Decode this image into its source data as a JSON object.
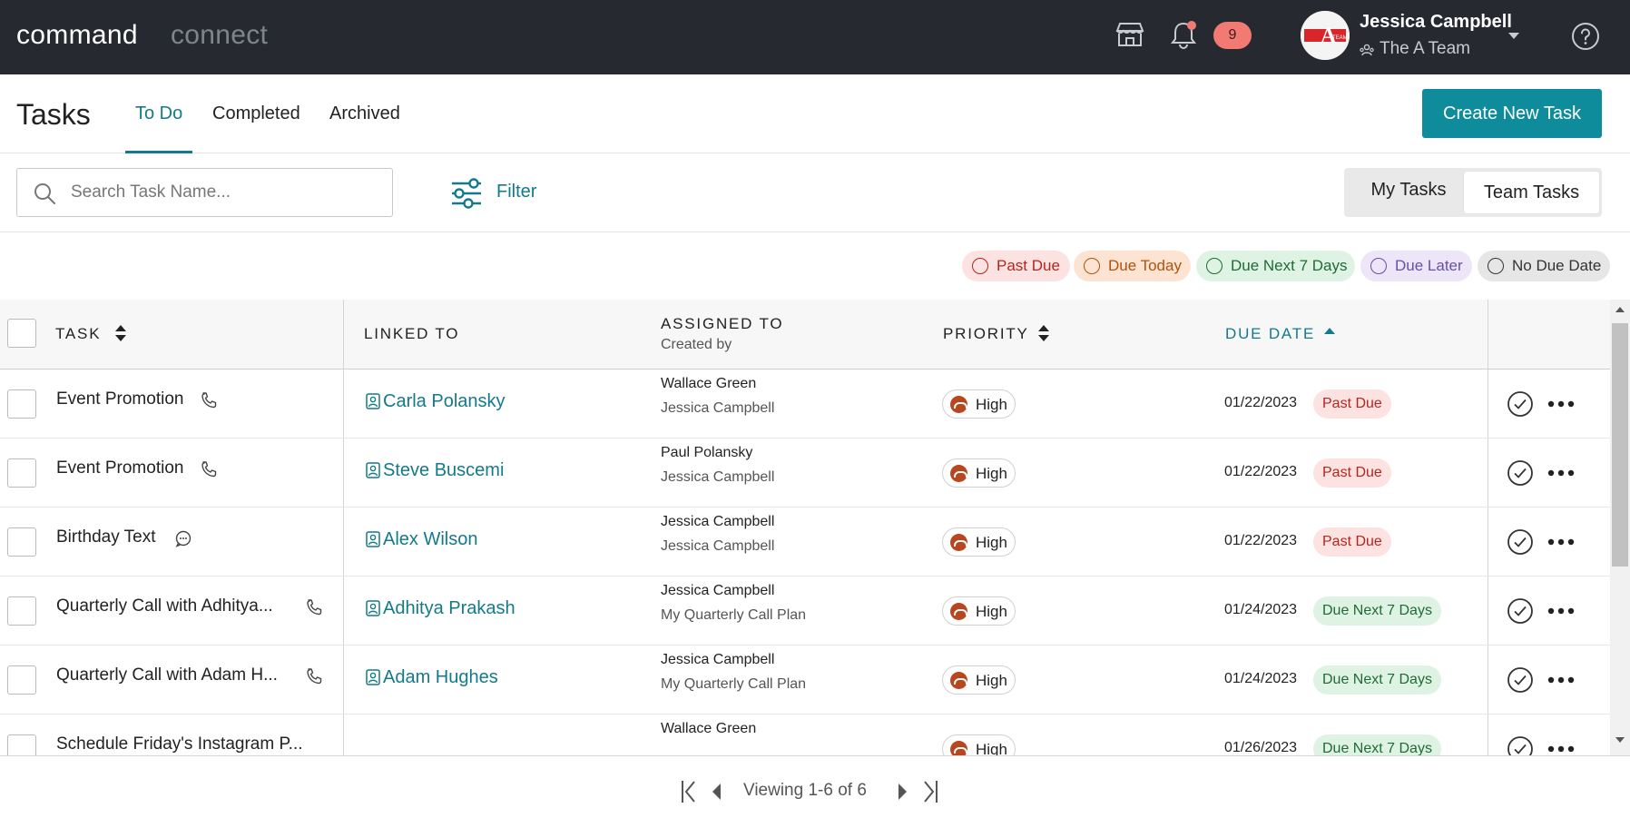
{
  "app": {
    "brand_primary": "command",
    "brand_secondary": "connect"
  },
  "topbar": {
    "notification_count": "9",
    "user_name": "Jessica Campbell",
    "team_name": "The A Team",
    "avatar_text": "A",
    "avatar_subtext": "TEAM"
  },
  "header": {
    "title": "Tasks",
    "tabs": [
      {
        "label": "To Do"
      },
      {
        "label": "Completed"
      },
      {
        "label": "Archived"
      }
    ],
    "active_tab": "To Do",
    "create_button": "Create New Task"
  },
  "toolbar": {
    "search_placeholder": "Search Task Name...",
    "search_value": "",
    "filter_label": "Filter",
    "view_toggle": [
      {
        "label": "My Tasks"
      },
      {
        "label": "Team Tasks"
      }
    ],
    "selected_view": "Team Tasks"
  },
  "legend": [
    {
      "label": "Past Due",
      "bg": "#fde2e2",
      "fg": "#b3261e"
    },
    {
      "label": "Due Today",
      "bg": "#fde4d2",
      "fg": "#b05210"
    },
    {
      "label": "Due Next 7 Days",
      "bg": "#dff3e4",
      "fg": "#1f6b36"
    },
    {
      "label": "Due Later",
      "bg": "#ece6f8",
      "fg": "#6a4fa8"
    },
    {
      "label": "No Due Date",
      "bg": "#e6e6e6",
      "fg": "#333333"
    }
  ],
  "table": {
    "columns": {
      "task": "TASK",
      "linked_to": "LINKED TO",
      "assigned_to": "ASSIGNED TO",
      "created_by": "Created by",
      "priority": "PRIORITY",
      "due_date": "DUE DATE"
    },
    "rows": [
      {
        "task": "Event Promotion",
        "task_icon": "phone-icon",
        "linked": "Carla Polansky",
        "assigned": "Wallace Green",
        "created": "Jessica Campbell",
        "priority": "High",
        "due": "01/22/2023",
        "status": "Past Due"
      },
      {
        "task": "Event Promotion",
        "task_icon": "phone-icon",
        "linked": "Steve Buscemi",
        "assigned": "Paul Polansky",
        "created": "Jessica Campbell",
        "priority": "High",
        "due": "01/22/2023",
        "status": "Past Due"
      },
      {
        "task": "Birthday Text",
        "task_icon": "chat-icon",
        "linked": "Alex Wilson",
        "assigned": "Jessica Campbell",
        "created": "Jessica Campbell",
        "priority": "High",
        "due": "01/22/2023",
        "status": "Past Due"
      },
      {
        "task": "Quarterly Call with Adhitya...",
        "task_icon": "phone-icon",
        "linked": "Adhitya Prakash",
        "assigned": "Jessica Campbell",
        "created": "My Quarterly Call Plan",
        "priority": "High",
        "due": "01/24/2023",
        "status": "Due Next 7 Days"
      },
      {
        "task": "Quarterly Call with Adam H...",
        "task_icon": "phone-icon",
        "linked": "Adam Hughes",
        "assigned": "Jessica Campbell",
        "created": "My Quarterly Call Plan",
        "priority": "High",
        "due": "01/24/2023",
        "status": "Due Next 7 Days"
      },
      {
        "task": "Schedule Friday's Instagram P...",
        "task_icon": "",
        "linked": "",
        "assigned": "Wallace Green",
        "created": "",
        "priority": "High",
        "due": "01/26/2023",
        "status": "Due Next 7 Days"
      }
    ]
  },
  "pagination": {
    "label": "Viewing 1-6 of 6"
  }
}
